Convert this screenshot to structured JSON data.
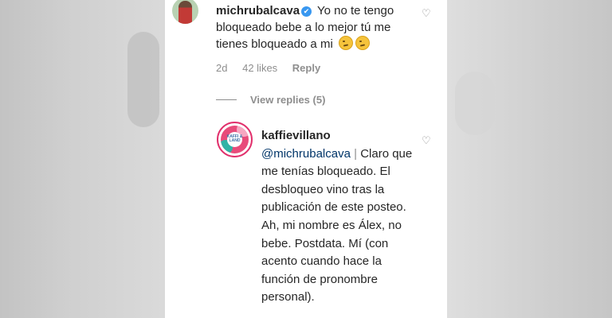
{
  "comment1": {
    "username": "michrubalcava",
    "verified_badge": "✔",
    "text": "Yo no te tengo bloqueado bebe a lo mejor tú me tienes bloqueado a mi",
    "emoji": "thinking-face",
    "age": "2d",
    "likes": "42 likes",
    "reply_label": "Reply",
    "view_replies": "View replies (5)"
  },
  "comment2": {
    "username": "kaffievillano",
    "avatar_text": "KAFFI & LAND",
    "mention": "@michrubalcava",
    "separator": "|",
    "text": "Claro que me tenías bloqueado. El desbloqueo vino tras la publicación de este posteo. Ah, mi nombre es Álex, no bebe. Postdata. Mí (con acento cuando hace la función de pronombre personal)."
  },
  "icons": {
    "heart": "♡"
  },
  "colors": {
    "text": "#262626",
    "secondary": "#8e8e8e",
    "verified": "#3897f0",
    "mention": "#003569"
  }
}
